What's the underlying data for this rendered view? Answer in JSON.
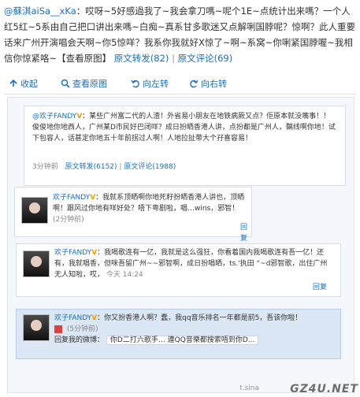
{
  "post": {
    "user": "@蘇淇aiSa__xKa",
    "text": "：哎呀~5好感過我了~我会拿刀嗎~呢个1E~点统计出来嗎？一个人红5红~5系由自己把口讲出来嗎~白痴~真系甘多歌迷又点解唎国脖呢？惊啊？此人重要话来广州开演唱会天啊~你5惊咩？我系你我就好X惊了~啊~系窝~你唎紧国脖喔~我相信你惊紧咯~【查看原图】",
    "repost": "原文转发(82)",
    "comment": "原文评论(69)",
    "sep": "|"
  },
  "toolbar": {
    "collapse": "收起",
    "view_original": "查看原图",
    "rotate_left": "向左转",
    "rotate_right": "向右转"
  },
  "quote": {
    "user": "@欢子FANDY",
    "text": "：某些广州富二代的人渣！外省易小朋友在地铁病厥又点？佢原本就没嘴事！！俊俊地你地西人，广州某D市民好巴闭咩？成日扮晒香港人讲，点扮都是广州人，黐线啊你地！试下包容人，话甚定你地五十年前拐过人啊！人地拉扯带大个孖喜容易！",
    "time": "3分钟前",
    "repost": "原文转发(6152)",
    "comment": "原文评论(1988)"
  },
  "c1": {
    "name": "欢子FANDY",
    "text": "：我就系顶晒啊你地死籽扮晒香港人讲也，顶晒啊！跟风过你地有咩好处？唔下粤剧啦，唱…wins，邪智！",
    "time": "(2分钟前)",
    "reply": "回复"
  },
  "c2": {
    "name": "欢子FANDY",
    "text": "：我喝歌连有一亿，我就是这么强狂，你看着国内我喝歌连有吾一亿！还有，我就唱香，但咪吾留广州~~邪智啊，成日扮唱晒，ts.'执田 “~d邪智歌，出住广州无人知啦，哎，",
    "time": "今天 14:24",
    "reply": "回复"
  },
  "c3": {
    "name": "欢子FANDY",
    "text": "：你又扮香港人啊？蠢，我qq音乐排名一年都是前5，吾该你啦！",
    "time": "(5分钟前)",
    "reply": "回复我的微博：",
    "reply_text": "你D二打六歌手… 連QQ音樂都搜索唔到你D..."
  },
  "watermark": {
    "site": "GZ4U.NET",
    "sina": "t.sina"
  }
}
